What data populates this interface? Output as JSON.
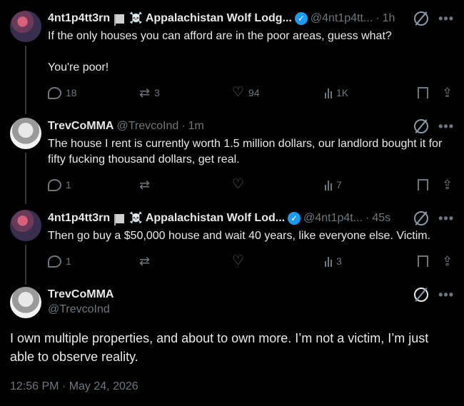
{
  "tweets": [
    {
      "name": "4nt1p4tt3rn",
      "name_suffix": "Appalachistan Wolf Lodg...",
      "handle": "@4nt1p4tt...",
      "time": "1h",
      "text": "If the only houses you can afford are in the poor areas, guess what?\n\nYou're poor!",
      "replies": "18",
      "reposts": "3",
      "likes": "94",
      "views": "1K"
    },
    {
      "name": "TrevCoMMA",
      "handle": "@TrevcoInd",
      "time": "1m",
      "text": "The house I rent is currently worth 1.5 million dollars, our landlord bought it for fifty fucking thousand dollars, get real.",
      "replies": "1",
      "reposts": "",
      "likes": "",
      "views": "7"
    },
    {
      "name": "4nt1p4tt3rn",
      "name_suffix": "Appalachistan Wolf Lod...",
      "handle": "@4nt1p4t...",
      "time": "45s",
      "text": "Then go buy a $50,000 house and wait 40 years, like everyone else. Victim.",
      "replies": "1",
      "reposts": "",
      "likes": "",
      "views": "3"
    }
  ],
  "main": {
    "name": "TrevCoMMA",
    "handle": "@TrevcoInd",
    "text": "I own multiple properties, and about to own more. I’m not a victim, I’m just able to observe reality.",
    "timestamp": "12:56 PM · May 24, 2026"
  },
  "separator": "·",
  "icons": {
    "grok": "grok-icon",
    "more": "•••",
    "verified": "✓",
    "skull": "☠️",
    "repost": "⇄",
    "like": "♡",
    "share": "⇪"
  }
}
